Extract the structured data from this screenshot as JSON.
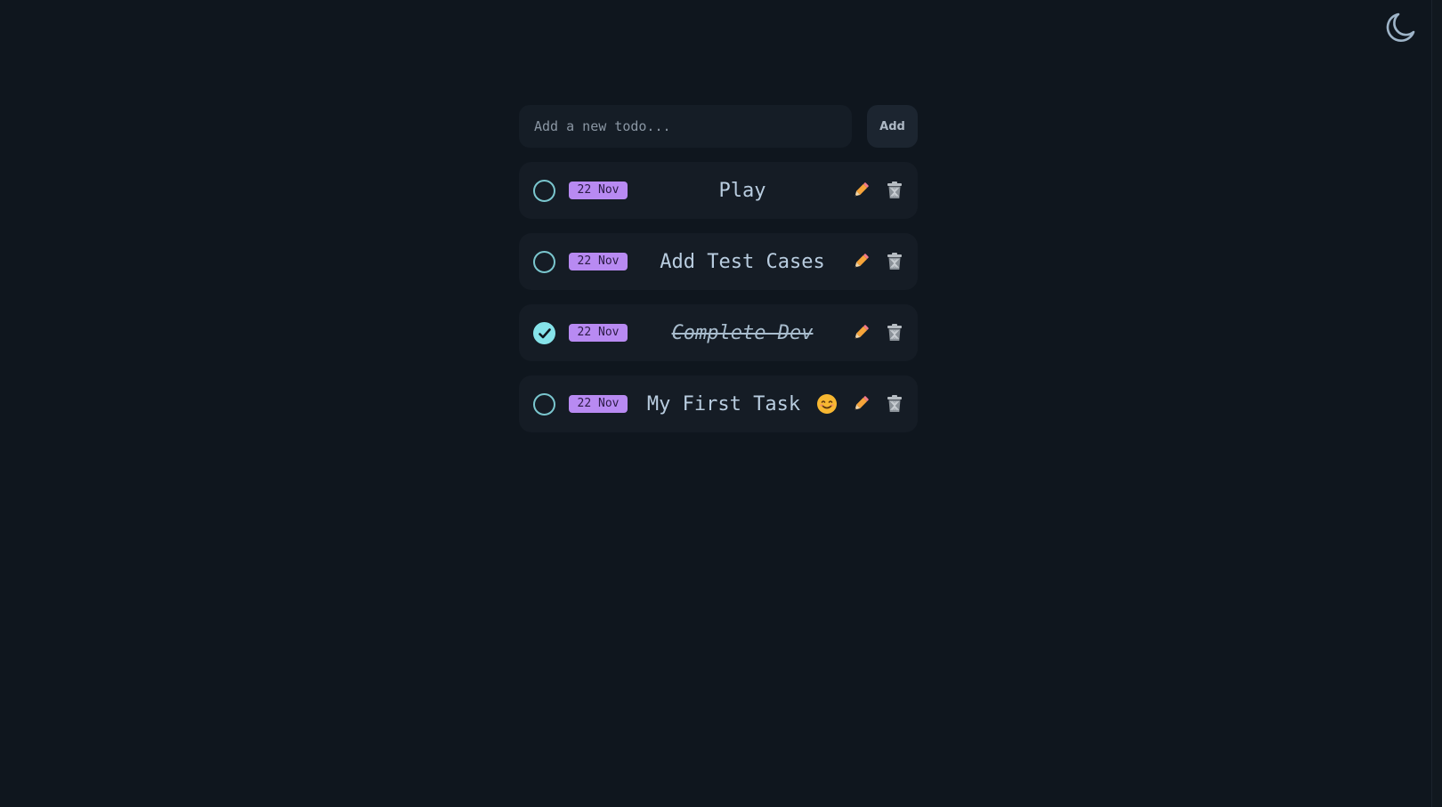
{
  "header": {
    "theme_toggle_icon": "moon-icon"
  },
  "add_form": {
    "placeholder": "Add a new todo...",
    "value": "",
    "add_label": "Add"
  },
  "todos": [
    {
      "date": "22 Nov",
      "text": "Play",
      "completed": false,
      "emoji": ""
    },
    {
      "date": "22 Nov",
      "text": "Add Test Cases",
      "completed": false,
      "emoji": ""
    },
    {
      "date": "22 Nov",
      "text": "Complete Dev",
      "completed": true,
      "emoji": ""
    },
    {
      "date": "22 Nov",
      "text": "My First Task",
      "completed": false,
      "emoji": "smiling-face-icon"
    }
  ],
  "icons": {
    "edit": "pencil-icon",
    "delete": "trash-icon"
  },
  "colors": {
    "background": "#0f161e",
    "card": "#151c25",
    "date_badge": "#b88af2",
    "check_done": "#86e3ea",
    "check_border": "#7ac6ce",
    "text": "#b9cde0"
  }
}
